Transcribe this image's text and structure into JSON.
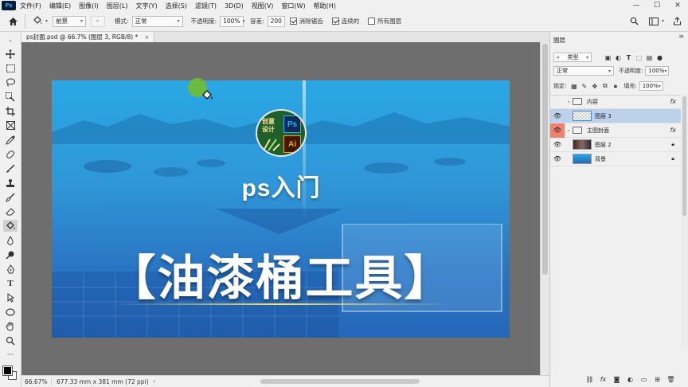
{
  "app": {
    "logo": "Ps"
  },
  "menu": [
    "文件(F)",
    "编辑(E)",
    "图像(I)",
    "图层(L)",
    "文字(Y)",
    "选择(S)",
    "滤镜(T)",
    "3D(D)",
    "视图(V)",
    "窗口(W)",
    "帮助(H)"
  ],
  "window_controls": {
    "minimize": "—",
    "maximize": "☐",
    "close": "✕"
  },
  "options": {
    "fill_source": "前景",
    "mode_label": "模式:",
    "mode_value": "正常",
    "opacity_label": "不透明度:",
    "opacity_value": "100%",
    "tolerance_label": "容差:",
    "tolerance_value": "200",
    "antialias_label": "消除锯齿",
    "contiguous_label": "连续的",
    "all_layers_label": "所有图层",
    "antialias_checked": true,
    "contiguous_checked": true,
    "all_layers_checked": false
  },
  "document_tab": {
    "title": "ps封面.psd @ 66.7% (图层 3, RGB/8) *",
    "close": "×"
  },
  "canvas": {
    "badge_line1": "创意",
    "badge_line2": "设计",
    "badge_ps": "Ps",
    "badge_ai": "Ai",
    "subtitle": "ps入门",
    "headline": "【油漆桶工具】"
  },
  "status": {
    "zoom": "66.67%",
    "dimensions": "677.33 mm x 381 mm (72 ppi)",
    "chevron": "›"
  },
  "layers_panel": {
    "title": "图层",
    "close": "≡",
    "filter_type": "类型",
    "blend_mode": "正常",
    "opacity_label": "不透明度:",
    "opacity_value": "100%",
    "lock_label": "锁定:",
    "fill_label": "填充:",
    "fill_value": "100%",
    "layers": [
      {
        "name": "内容",
        "kind": "group",
        "visible": false,
        "fx": "fx",
        "selected": false
      },
      {
        "name": "图层 3",
        "kind": "transparent",
        "visible": true,
        "fx": "",
        "selected": true
      },
      {
        "name": "主图封面",
        "kind": "group",
        "visible": true,
        "fx": "fx",
        "selected": false
      },
      {
        "name": "图层 2",
        "kind": "photo",
        "visible": true,
        "fx": "",
        "selected": false
      },
      {
        "name": "背景",
        "kind": "blue",
        "visible": true,
        "fx": "",
        "selected": false
      }
    ]
  },
  "colors": {
    "accent_blue": "#31a8ff",
    "canvas_top": "#2aa7e4",
    "canvas_bottom": "#2567b8",
    "selected_layer": "#bcd2ec",
    "cursor_green": "#76be28"
  }
}
